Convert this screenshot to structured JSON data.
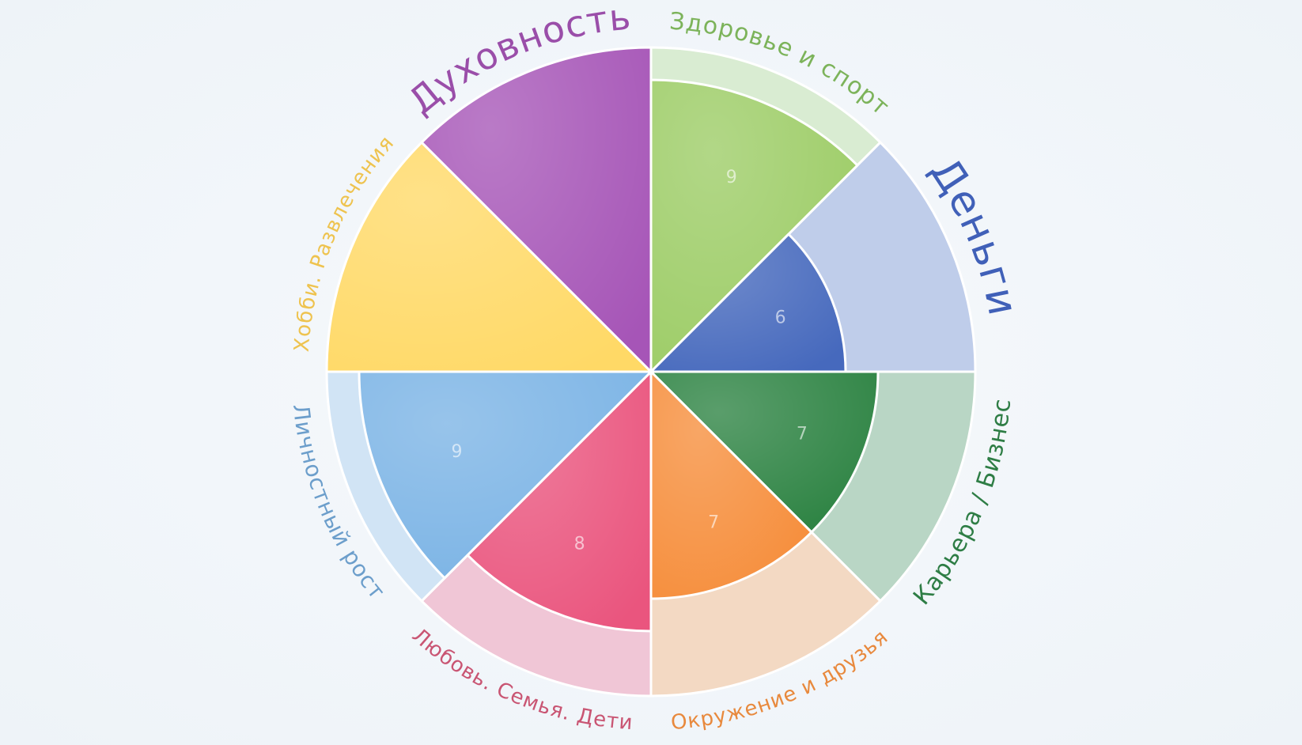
{
  "chart_data": {
    "type": "polar-area",
    "title": "",
    "max_value": 10,
    "segments": [
      {
        "label": "Здоровье и спорт",
        "value": 9,
        "value_shown": true,
        "color": "#9ccc65",
        "light_color": "#d9ecd2",
        "label_size": 30,
        "label_color": "#7cb35a"
      },
      {
        "label": "Деньги",
        "value": 6,
        "value_shown": true,
        "color": "#4669bd",
        "light_color": "#bfcdea",
        "label_size": 52,
        "label_color": "#4060b8"
      },
      {
        "label": "Карьера / Бизнес",
        "value": 7,
        "value_shown": true,
        "color": "#2b8241",
        "light_color": "#b9d6c5",
        "label_size": 30,
        "label_color": "#2e7d45"
      },
      {
        "label": "Окружение и друзья",
        "value": 7,
        "value_shown": true,
        "color": "#f68d3a",
        "light_color": "#f3d9c3",
        "label_size": 26,
        "label_color": "#e8893d"
      },
      {
        "label": "Любовь. Семья. Дети",
        "value": 8,
        "value_shown": true,
        "color": "#ea557e",
        "light_color": "#f0c6d6",
        "label_size": 26,
        "label_color": "#c95573"
      },
      {
        "label": "Личностный рост",
        "value": 9,
        "value_shown": true,
        "color": "#7ab3e5",
        "light_color": "#d1e4f5",
        "label_size": 28,
        "label_color": "#6c9ecb"
      },
      {
        "label": "Хобби. Развлечения",
        "value": 10,
        "value_shown": false,
        "color": "#ffd966",
        "light_color": "#fff0b8",
        "label_size": 26,
        "label_color": "#eec34f"
      },
      {
        "label": "Духовность",
        "value": 10,
        "value_shown": false,
        "color": "#a655b7",
        "light_color": "#e3c8ea",
        "label_size": 46,
        "label_color": "#9a4ea9"
      }
    ]
  }
}
